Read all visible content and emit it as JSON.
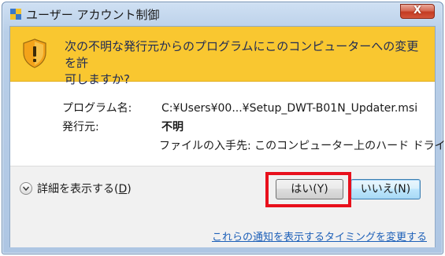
{
  "window": {
    "title": "ユーザー アカウント制御",
    "close_label": "X"
  },
  "banner": {
    "line1": "次の不明な発行元からのプログラムにこのコンピューターへの変更を許",
    "line2": "可しますか?"
  },
  "details": {
    "program_label": "プログラム名:",
    "program_value": "C:¥Users¥00...¥Setup_DWT-B01N_Updater.msi",
    "publisher_label": "発行元:",
    "publisher_value": "不明",
    "origin_text": "ファイルの入手先: このコンピューター上のハード ドライブ"
  },
  "footer": {
    "show_details_label": "詳細を表示する(",
    "show_details_key": "D",
    "show_details_end": ")",
    "yes_button": "はい(Y)",
    "no_button": "いいえ(N)",
    "settings_link": "これらの通知を表示するタイミングを変更する"
  },
  "colors": {
    "banner": "#f9c730",
    "highlight": "#e8101c",
    "link": "#1c5fb8"
  }
}
